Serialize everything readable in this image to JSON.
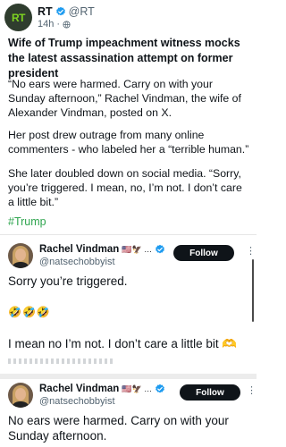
{
  "post": {
    "author": "RT",
    "handle": "@RT",
    "avatar_text": "RT",
    "time": "14h",
    "separator": "·",
    "title": "Wife of Trump impeachment witness mocks the latest assassination attempt on former president",
    "paragraphs": [
      "“No ears were harmed. Carry on with your Sunday afternoon,” Rachel Vindman, the wife of Alexander Vindman, posted on X.",
      "Her post drew outrage from many online commenters - who labeled her a “terrible human.”",
      "She later doubled down on social media. “Sorry, you’re triggered. I mean, no, I’m not. I don’t care a little bit.”"
    ],
    "hashtag": "#Trump"
  },
  "embedded": [
    {
      "name": "Rachel Vindman",
      "flags": "🇺🇸🦅 …",
      "handle": "@natsechobbyist",
      "follow_label": "Follow",
      "more": "⋮",
      "text_1": "Sorry you’re triggered.",
      "emojis": "🤣🤣🤣",
      "text_2": "I mean no I’m not. I don’t care a little bit 🫶"
    },
    {
      "name": "Rachel Vindman",
      "flags": "🇺🇸🦅 …",
      "handle": "@natsechobbyist",
      "follow_label": "Follow",
      "more": "⋮",
      "text": "No ears were harmed. Carry on with your Sunday afternoon."
    }
  ],
  "colors": {
    "verified_blue": "#1d9bf0",
    "hashtag_green": "#2fa54f",
    "rt_brand_green": "#7ed321",
    "follow_button": "#0f1419"
  },
  "icons": {
    "verified": "verified-badge-icon",
    "audience": "globe-icon",
    "more": "more-options-icon"
  }
}
